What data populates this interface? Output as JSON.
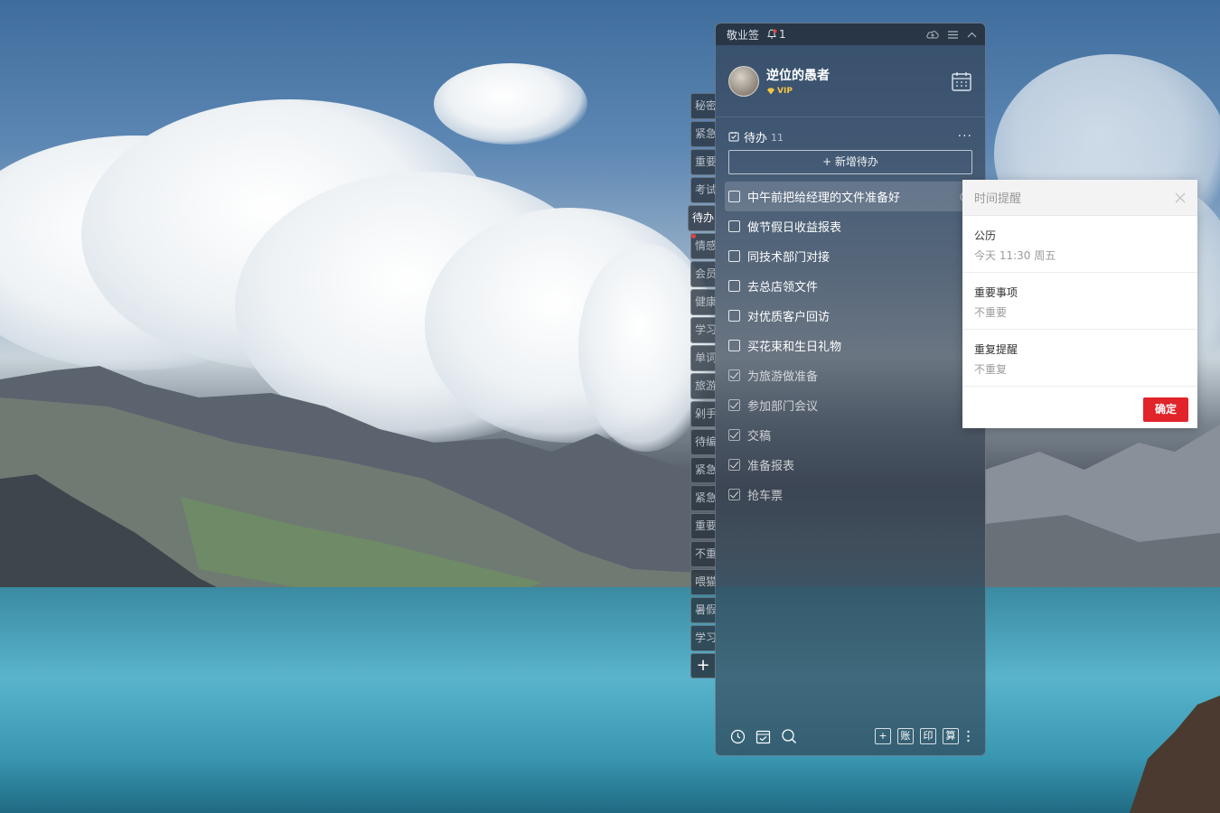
{
  "app": {
    "title": "敬业签",
    "notification_count": "1"
  },
  "profile": {
    "username": "逆位的愚者",
    "badge": "VIP"
  },
  "side_tabs": [
    {
      "label": "秘密"
    },
    {
      "label": "紧急"
    },
    {
      "label": "重要"
    },
    {
      "label": "考试"
    },
    {
      "label": "待办"
    },
    {
      "label": "情感"
    },
    {
      "label": "会员"
    },
    {
      "label": "健康"
    },
    {
      "label": "学习"
    },
    {
      "label": "单词"
    },
    {
      "label": "旅游"
    },
    {
      "label": "剁手"
    },
    {
      "label": "待编"
    },
    {
      "label": "紧急"
    },
    {
      "label": "紧急"
    },
    {
      "label": "重要"
    },
    {
      "label": "不重"
    },
    {
      "label": "喂猫"
    },
    {
      "label": "暑假"
    },
    {
      "label": "学习"
    }
  ],
  "side_add_label": "+",
  "list": {
    "title": "待办",
    "count": "11",
    "more_label": "···",
    "add_label": "+ 新增待办",
    "items": [
      {
        "text": "中午前把给经理的文件准备好",
        "done": false
      },
      {
        "text": "做节假日收益报表",
        "done": false
      },
      {
        "text": "同技术部门对接",
        "done": false
      },
      {
        "text": "去总店领文件",
        "done": false
      },
      {
        "text": "对优质客户回访",
        "done": false
      },
      {
        "text": "买花束和生日礼物",
        "done": false
      },
      {
        "text": "为旅游做准备",
        "done": true
      },
      {
        "text": "参加部门会议",
        "done": true
      },
      {
        "text": "交稿",
        "done": true
      },
      {
        "text": "准备报表",
        "done": true
      },
      {
        "text": "抢车票",
        "done": true
      }
    ]
  },
  "bottom_bar": {
    "btn_add": "+",
    "btn_account": "账",
    "btn_print": "印",
    "btn_calc": "算"
  },
  "popup": {
    "title": "时间提醒",
    "rows": [
      {
        "label": "公历",
        "value": "今天 11:30 周五"
      },
      {
        "label": "重要事项",
        "value": "不重要"
      },
      {
        "label": "重复提醒",
        "value": "不重复"
      }
    ],
    "confirm_label": "确定"
  }
}
